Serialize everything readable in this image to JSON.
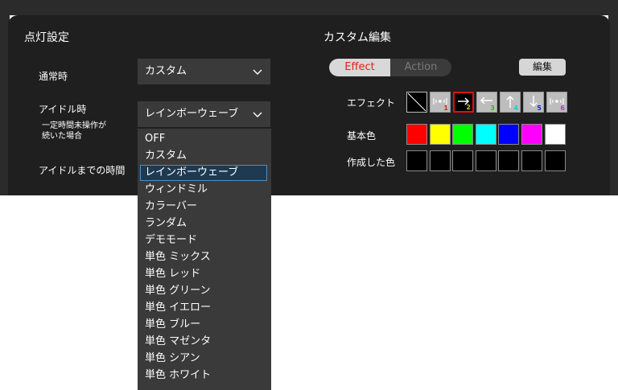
{
  "section_lighting": "点灯設定",
  "section_custom": "カスタム編集",
  "normal": {
    "label": "通常時",
    "value": "カスタム"
  },
  "idle": {
    "label": "アイドル時",
    "sublabel_line1": "一定時間未操作が",
    "sublabel_line2": "続いた場合",
    "value": "レインボーウェーブ"
  },
  "idle_time": {
    "label": "アイドルまでの時間"
  },
  "dropdown": {
    "options": [
      "OFF",
      "カスタム",
      "レインボーウェーブ",
      "ウィンドミル",
      "カラーバー",
      "ランダム",
      "デモモード",
      "単色 ミックス",
      "単色 レッド",
      "単色 グリーン",
      "単色 イエロー",
      "単色 ブルー",
      "単色 マゼンタ",
      "単色 シアン",
      "単色 ホワイト"
    ],
    "selected_index": 2
  },
  "mode_toggle": {
    "effect": "Effect",
    "action": "Action",
    "active": "Effect"
  },
  "edit_button": "編集",
  "effect": {
    "label": "エフェクト",
    "icons": [
      "none-icon",
      "ripple-icon",
      "arrow-right-icon",
      "arrow-left-icon",
      "arrow-up-icon",
      "arrow-down-icon",
      "ripple-icon"
    ],
    "numbers": [
      "",
      "1",
      "2",
      "3",
      "4",
      "5",
      "6"
    ],
    "number_colors": [
      "",
      "#e02020",
      "#e0c000",
      "#20c020",
      "#20c8d8",
      "#2020e0",
      "#e020e0"
    ],
    "active_index": 2
  },
  "basic_colors": {
    "label": "基本色",
    "colors": [
      "#ff0000",
      "#ffff00",
      "#00ff00",
      "#00ffff",
      "#0000ff",
      "#ff00ff",
      "#ffffff"
    ]
  },
  "created_colors": {
    "label": "作成した色",
    "colors": [
      "#000000",
      "#000000",
      "#000000",
      "#000000",
      "#000000",
      "#000000",
      "#000000"
    ]
  }
}
